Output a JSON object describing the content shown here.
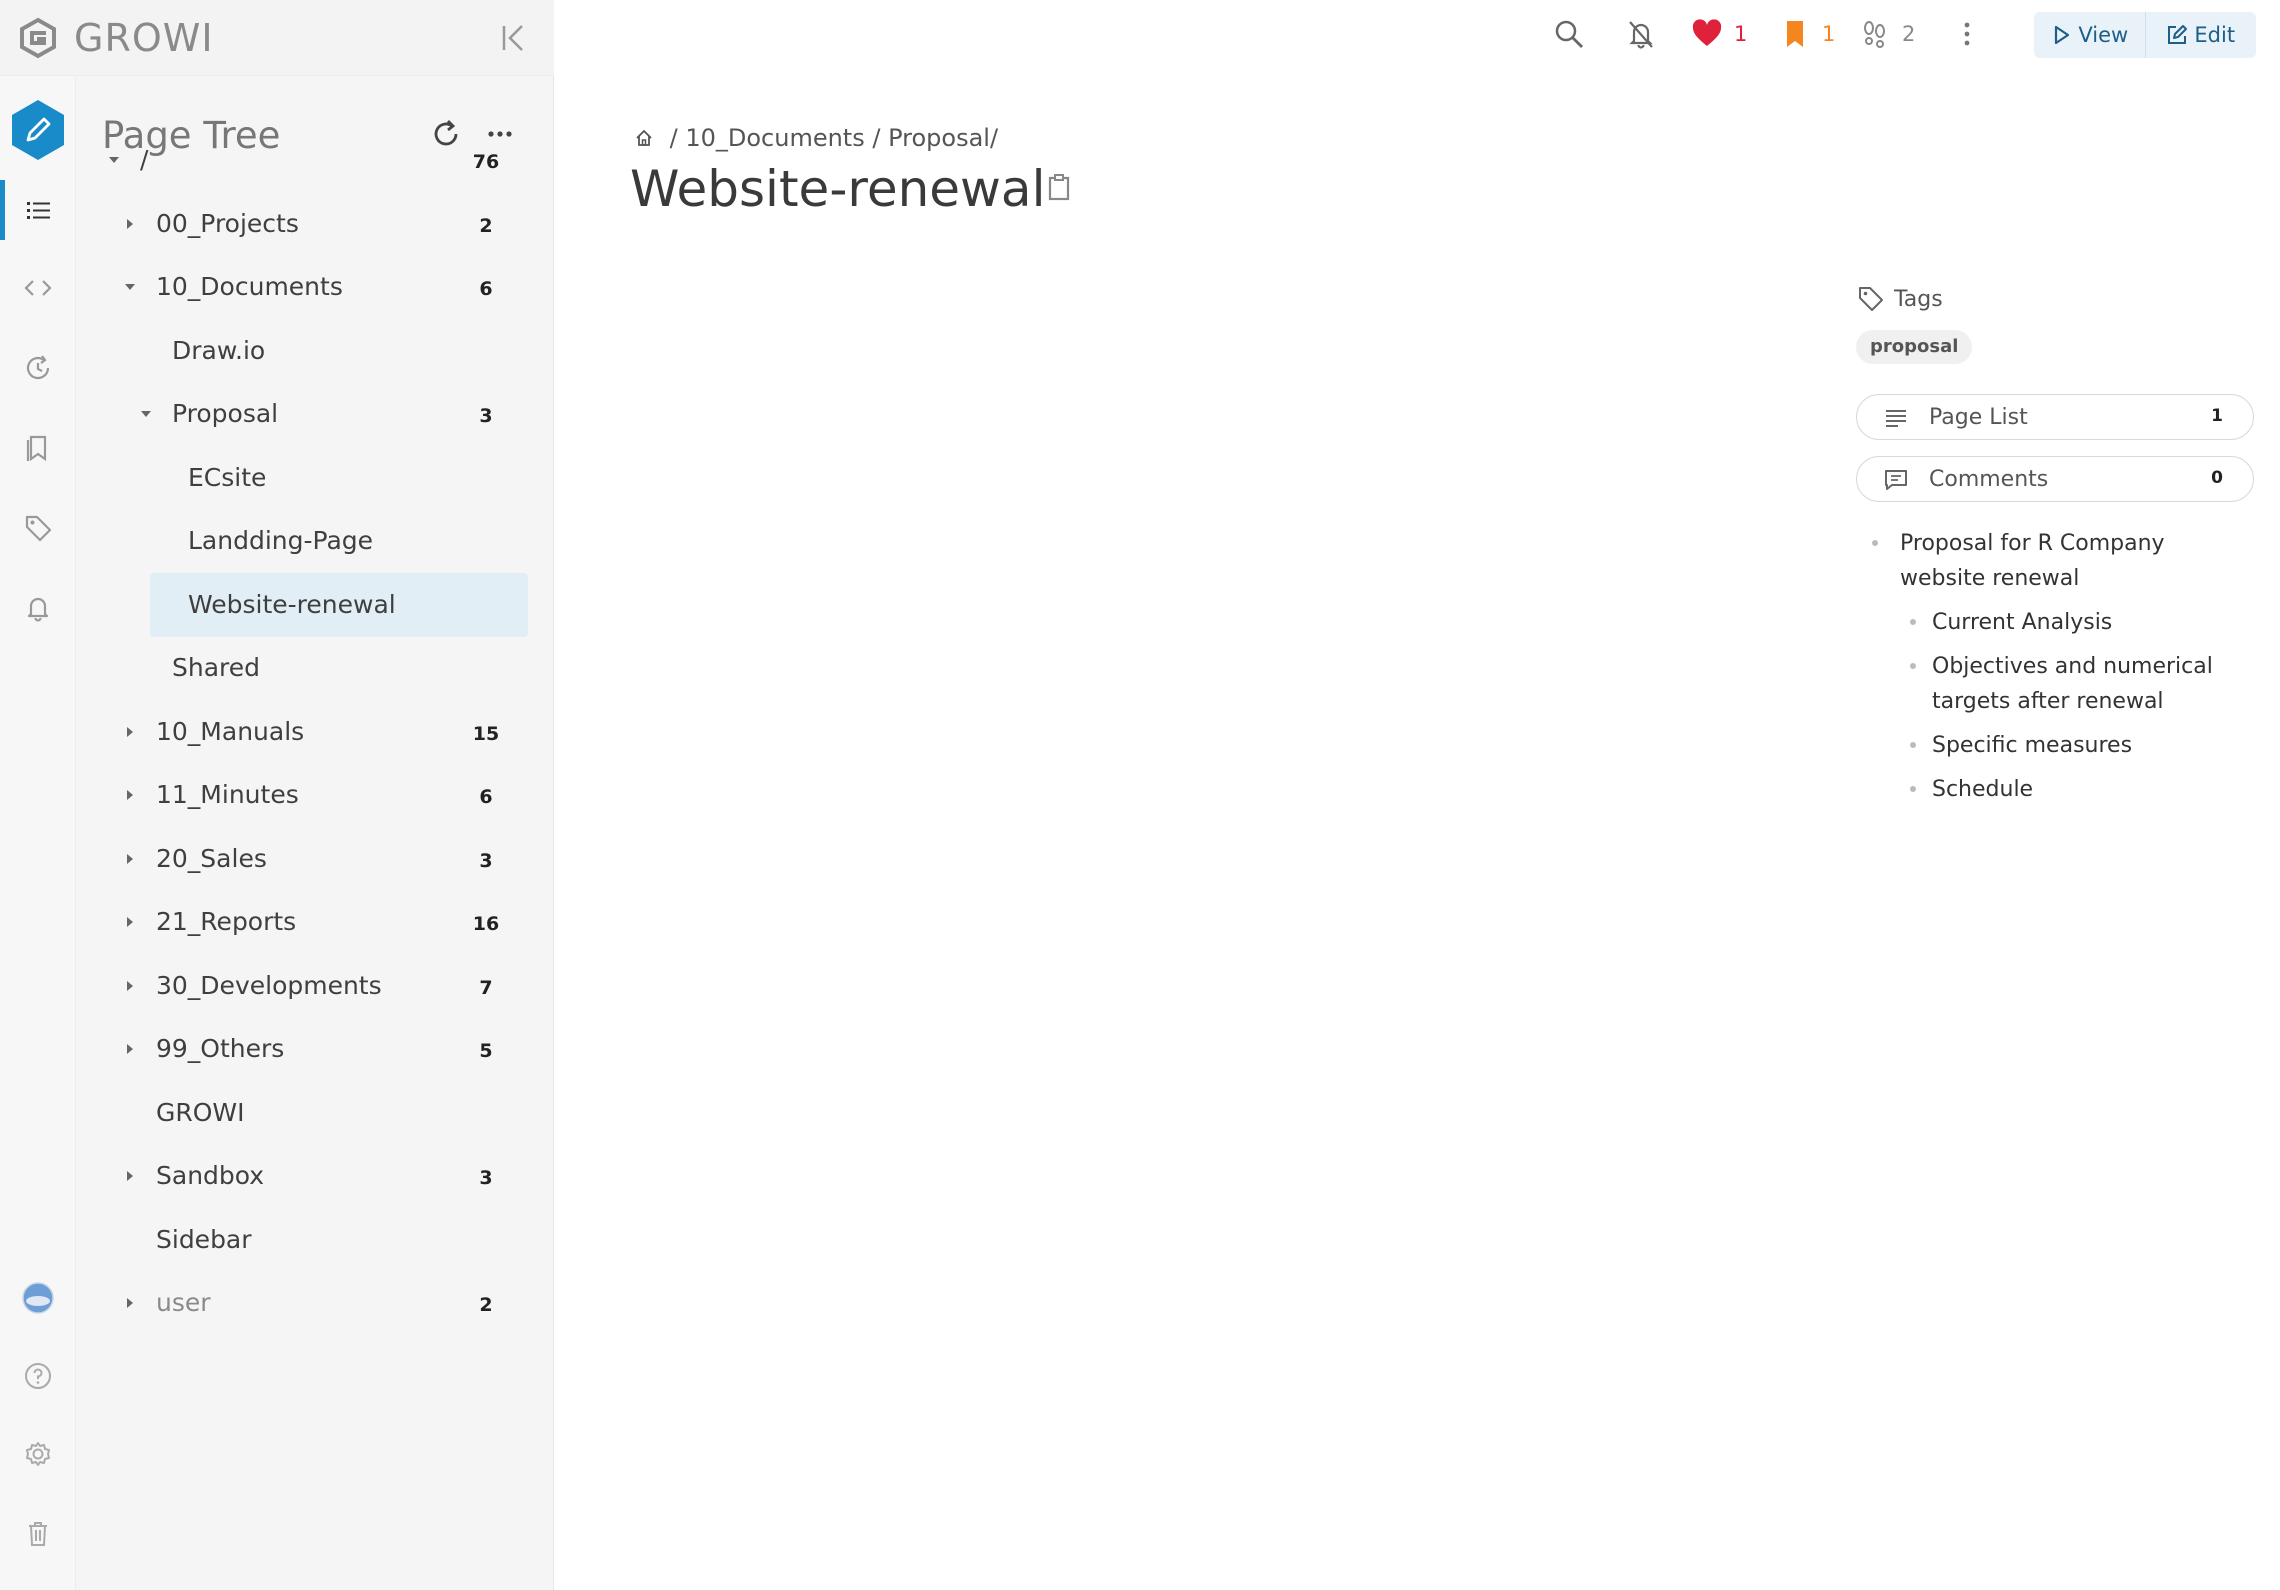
{
  "app": {
    "name": "GROWI"
  },
  "colors": {
    "accent": "#1a8bc9",
    "heart": "#e0213b",
    "bookmark": "#f5861f",
    "selected_bg": "#e1eef5"
  },
  "topbar": {
    "likes": "1",
    "bookmarks": "1",
    "seen_users": "2",
    "view_label": "View",
    "edit_label": "Edit"
  },
  "sidebar": {
    "title": "Page Tree",
    "tree": [
      {
        "label": "/",
        "count": "76",
        "expanded": true,
        "has_children": true
      },
      {
        "label": "00_Projects",
        "count": "2",
        "has_children": true
      },
      {
        "label": "10_Documents",
        "count": "6",
        "expanded": true,
        "has_children": true
      },
      {
        "label": "Draw.io",
        "count": ""
      },
      {
        "label": "Proposal",
        "count": "3",
        "expanded": true,
        "has_children": true
      },
      {
        "label": "ECsite",
        "count": ""
      },
      {
        "label": "Landding-Page",
        "count": ""
      },
      {
        "label": "Website-renewal",
        "count": "",
        "selected": true
      },
      {
        "label": "Shared",
        "count": ""
      },
      {
        "label": "10_Manuals",
        "count": "15",
        "has_children": true
      },
      {
        "label": "11_Minutes",
        "count": "6",
        "has_children": true
      },
      {
        "label": "20_Sales",
        "count": "3",
        "has_children": true
      },
      {
        "label": "21_Reports",
        "count": "16",
        "has_children": true
      },
      {
        "label": "30_Developments",
        "count": "7",
        "has_children": true
      },
      {
        "label": "99_Others",
        "count": "5",
        "has_children": true
      },
      {
        "label": "GROWI",
        "count": ""
      },
      {
        "label": "Sandbox",
        "count": "3",
        "has_children": true
      },
      {
        "label": "Sidebar",
        "count": ""
      },
      {
        "label": "user",
        "count": "2",
        "has_children": true,
        "muted": true
      }
    ]
  },
  "page": {
    "breadcrumb": [
      {
        "label": "10_Documents"
      },
      {
        "label": "Proposal"
      }
    ],
    "title": "Website-renewal"
  },
  "side_panel": {
    "tags_label": "Tags",
    "tags": [
      "proposal"
    ],
    "page_list_label": "Page List",
    "page_list_count": "1",
    "comments_label": "Comments",
    "comments_count": "0",
    "toc": [
      {
        "text": "Proposal for R Company website renewal",
        "level": 1
      },
      {
        "text": "Current Analysis",
        "level": 2
      },
      {
        "text": "Objectives and numerical targets after renewal",
        "level": 2
      },
      {
        "text": "Specific measures",
        "level": 2
      },
      {
        "text": "Schedule",
        "level": 2
      }
    ]
  }
}
